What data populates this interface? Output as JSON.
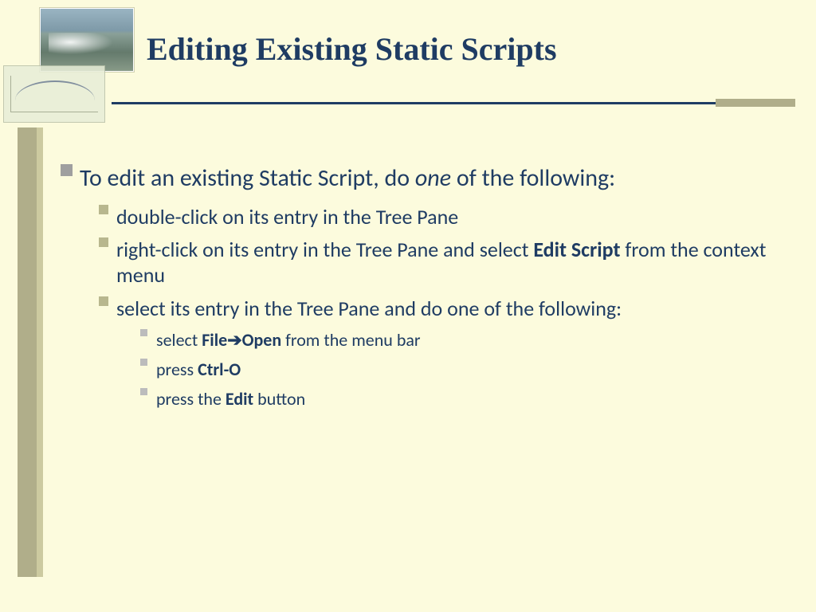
{
  "title": "Editing Existing Static Scripts",
  "intro": {
    "pre": "To edit an existing Static Script, do ",
    "em": "one",
    "post": " of the following:"
  },
  "bullets2": {
    "a": "double-click on its entry in the Tree Pane",
    "b": {
      "pre": "right-click on its entry in the Tree Pane and select ",
      "bold": "Edit Script",
      "post": " from the context menu"
    },
    "c": "select its entry in the Tree Pane and do one of the following:"
  },
  "bullets3": {
    "a": {
      "pre": "select ",
      "b1": "File",
      "arrow": "➔",
      "b2": "Open",
      "post": " from the menu bar"
    },
    "b": {
      "pre": "press ",
      "bold": "Ctrl-O"
    },
    "c": {
      "pre": "press the ",
      "bold": "Edit",
      "post": " button"
    }
  }
}
